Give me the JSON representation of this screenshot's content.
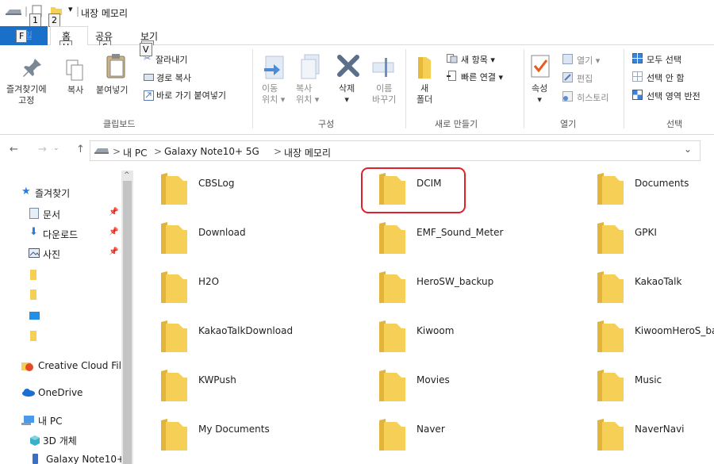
{
  "window": {
    "title": "내장 메모리",
    "qat_dropdown": "▾",
    "keytips": {
      "file": "F",
      "qat1": "1",
      "qat2": "2",
      "home": "H",
      "share": "S",
      "view": "V"
    }
  },
  "tabs": {
    "file": "파일",
    "home": "홈",
    "share": "공유",
    "view": "보기"
  },
  "ribbon": {
    "clipboard": {
      "pin": "즐겨찾기에\n고정",
      "copy": "복사",
      "paste": "붙여넣기",
      "cut": "잘라내기",
      "copy_path": "경로 복사",
      "paste_shortcut": "바로 가기 붙여넣기",
      "group": "클립보드"
    },
    "organize": {
      "move_to": "이동\n위치 ▾",
      "copy_to": "복사\n위치 ▾",
      "delete": "삭제\n▾",
      "rename": "이름\n바꾸기",
      "group": "구성"
    },
    "new": {
      "new_folder": "새\n폴더",
      "new_item": "새 항목 ▾",
      "easy_access": "빠른 연결 ▾",
      "group": "새로 만들기"
    },
    "open": {
      "properties": "속성\n▾",
      "open": "열기 ▾",
      "edit": "편집",
      "history": "히스토리",
      "group": "열기"
    },
    "select": {
      "select_all": "모두 선택",
      "select_none": "선택 안 함",
      "invert": "선택 영역 반전",
      "group": "선택"
    }
  },
  "address": {
    "back": "←",
    "forward": "→",
    "up": "↑",
    "crumbs": [
      "내 PC",
      "Galaxy Note10+ 5G",
      "내장 메모리"
    ],
    "sep": ">",
    "dropdown": "⌄"
  },
  "nav": {
    "items": [
      {
        "label": "즐겨찾기",
        "icon": "star-icon"
      },
      {
        "label": "문서",
        "icon": "document-icon",
        "pinned": true
      },
      {
        "label": "다운로드",
        "icon": "download-icon",
        "pinned": true
      },
      {
        "label": "사진",
        "icon": "picture-icon",
        "pinned": true
      },
      {
        "label": "",
        "icon": "folder-icon"
      },
      {
        "label": "",
        "icon": "folder-icon"
      },
      {
        "label": "",
        "icon": "monitor-icon"
      },
      {
        "label": "",
        "icon": "folder-icon"
      },
      {
        "label": "Creative Cloud Fil",
        "icon": "creative-cloud-icon"
      },
      {
        "label": "OneDrive",
        "icon": "onedrive-icon"
      },
      {
        "label": "내 PC",
        "icon": "pc-icon"
      },
      {
        "label": "3D 개체",
        "icon": "cube-icon"
      },
      {
        "label": "Galaxy Note10+",
        "icon": "phone-icon"
      }
    ]
  },
  "folders": [
    "CBSLog",
    "DCIM",
    "Documents",
    "Download",
    "EMF_Sound_Meter",
    "GPKI",
    "H2O",
    "HeroSW_backup",
    "KakaoTalk",
    "KakaoTalkDownload",
    "Kiwoom",
    "KiwoomHeroS_ba",
    "KWPush",
    "Movies",
    "Music",
    "My Documents",
    "Naver",
    "NaverNavi"
  ],
  "highlighted_folder": "DCIM",
  "colors": {
    "file_tab": "#1a6fc8",
    "folder": "#f6cf57",
    "highlight": "#e0202a"
  }
}
